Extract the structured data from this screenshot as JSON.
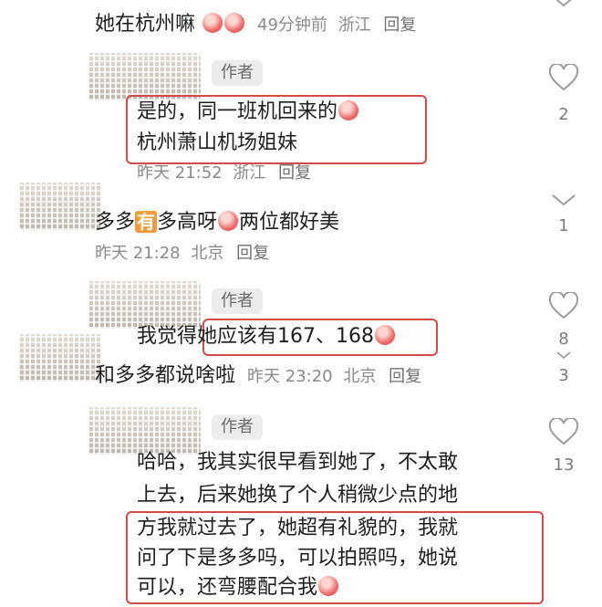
{
  "comments": [
    {
      "id": "c1",
      "text": "她在杭州嘛",
      "meta": {
        "time": "49分钟前",
        "location": "浙江",
        "reply": "回复"
      }
    },
    {
      "id": "r1",
      "author_badge": "作者",
      "lines": [
        "是的，同一班机回来的",
        "杭州萧山机场姐妹"
      ],
      "meta": {
        "time": "昨天 21:52",
        "location": "浙江",
        "reply": "回复"
      },
      "likes": "2"
    },
    {
      "id": "c2",
      "text_parts": [
        "多多",
        "有",
        "多高呀",
        "两位都好美"
      ],
      "meta": {
        "time": "昨天 21:28",
        "location": "北京",
        "reply": "回复"
      },
      "likes": "1"
    },
    {
      "id": "r2",
      "author_badge": "作者",
      "text_parts": [
        "我觉得",
        "她应该有167、168"
      ],
      "likes": "8"
    },
    {
      "id": "c3",
      "text": "和多多都说啥啦",
      "meta": {
        "time": "昨天 23:20",
        "location": "北京",
        "reply": "回复"
      },
      "likes": "3"
    },
    {
      "id": "r3",
      "author_badge": "作者",
      "lines": [
        "哈哈，我其实很早看到她了，不太敢",
        "上去，后来她换了个人稍微少点的地",
        "方我就过去了，她超有礼貌的，我就",
        "问了下是多多吗，可以拍照吗，她说",
        "可以，还弯腰配合我"
      ],
      "likes": "13"
    }
  ],
  "colors": {
    "highlight": "#d24a4a",
    "badge_bg": "#ececec",
    "meta": "#8a8a8a",
    "emoji_accent": "#f29b3a"
  }
}
